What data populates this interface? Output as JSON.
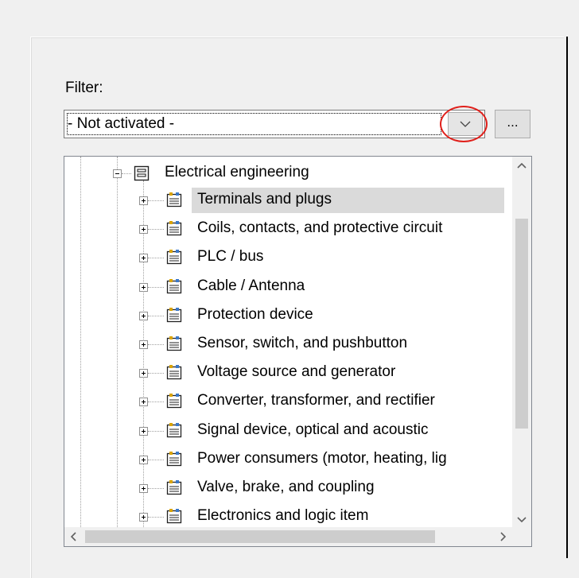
{
  "filter": {
    "label": "Filter:",
    "value": "- Not activated -",
    "dropdown_icon": "chevron-down-icon",
    "ellipsis_label": "..."
  },
  "tree": {
    "root": {
      "label": "Electrical engineering",
      "icon": "category-icon",
      "expanded": true
    },
    "items": [
      {
        "label": "Terminals and plugs",
        "selected": true
      },
      {
        "label": "Coils, contacts, and protective circuit"
      },
      {
        "label": "PLC / bus"
      },
      {
        "label": "Cable / Antenna"
      },
      {
        "label": "Protection device"
      },
      {
        "label": "Sensor, switch, and pushbutton"
      },
      {
        "label": "Voltage source and generator"
      },
      {
        "label": "Converter, transformer, and rectifier"
      },
      {
        "label": "Signal device, optical and acoustic"
      },
      {
        "label": "Power consumers (motor, heating, lig"
      },
      {
        "label": "Valve, brake, and coupling"
      },
      {
        "label": "Electronics and logic item"
      }
    ]
  },
  "colors": {
    "highlight_circle": "#e0201b",
    "selection": "#dadada",
    "scroll_thumb": "#cdcdcd"
  }
}
